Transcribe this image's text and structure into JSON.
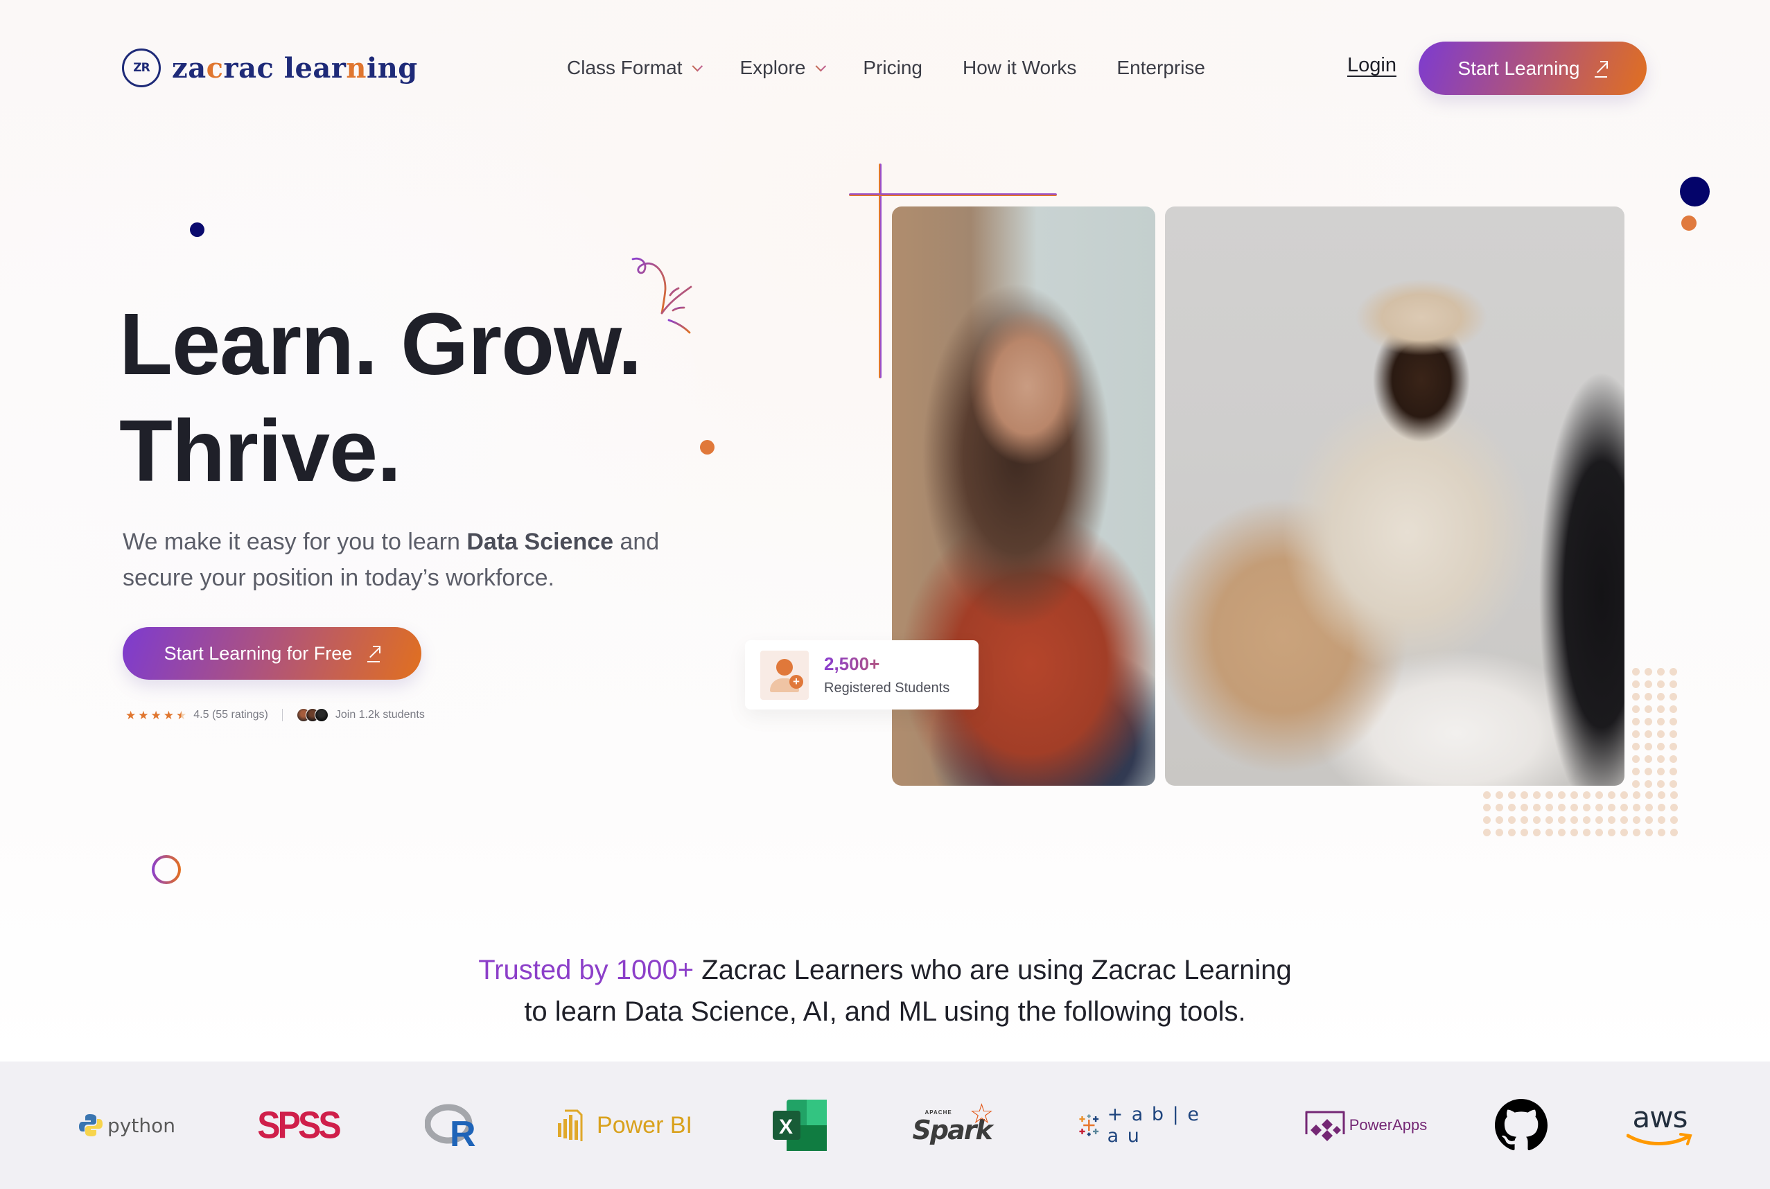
{
  "brand": {
    "name_part1": "za",
    "name_accent1": "c",
    "name_part2": "rac lear",
    "name_accent2": "n",
    "name_part3": "ing",
    "mark": "ZR",
    "colors": {
      "navy": "#1e2a78",
      "orange": "#e0762f",
      "purple": "#8a3dcf"
    }
  },
  "nav": {
    "items": [
      {
        "label": "Class Format",
        "has_dropdown": true
      },
      {
        "label": "Explore",
        "has_dropdown": true
      },
      {
        "label": "Pricing",
        "has_dropdown": false
      },
      {
        "label": "How it Works",
        "has_dropdown": false
      },
      {
        "label": "Enterprise",
        "has_dropdown": false
      }
    ],
    "login": "Login",
    "cta": "Start Learning",
    "cta_icon": "external-arrow-icon"
  },
  "hero": {
    "title_line1": "Learn. Grow.",
    "title_line2": "Thrive.",
    "subtitle_pre": "We make it easy for you to learn ",
    "subtitle_bold": "Data Science",
    "subtitle_post": " and secure your position in today’s workforce.",
    "cta": "Start Learning for Free",
    "rating": {
      "stars": 4.5,
      "text": "4.5 (55 ratings)"
    },
    "join_text": "Join 1.2k students"
  },
  "stat_card": {
    "value": "2,500+",
    "label": "Registered Students",
    "icon": "add-user-icon"
  },
  "trusted": {
    "highlight": "Trusted by 1000+",
    "rest_line1": " Zacrac Learners who are using Zacrac Learning",
    "line2": "to learn Data Science, AI, and ML using the following tools."
  },
  "tools": [
    {
      "name": "python",
      "label": "python"
    },
    {
      "name": "spss",
      "label": "SPSS"
    },
    {
      "name": "r",
      "label": "R"
    },
    {
      "name": "power-bi",
      "label": "Power BI"
    },
    {
      "name": "excel",
      "label": "X"
    },
    {
      "name": "spark",
      "label": "Spark",
      "sub": "APACHE"
    },
    {
      "name": "tableau",
      "label": "+ a b | e a u"
    },
    {
      "name": "powerapps",
      "label": "PowerApps"
    },
    {
      "name": "github",
      "label": ""
    },
    {
      "name": "aws",
      "label": "aws"
    }
  ]
}
